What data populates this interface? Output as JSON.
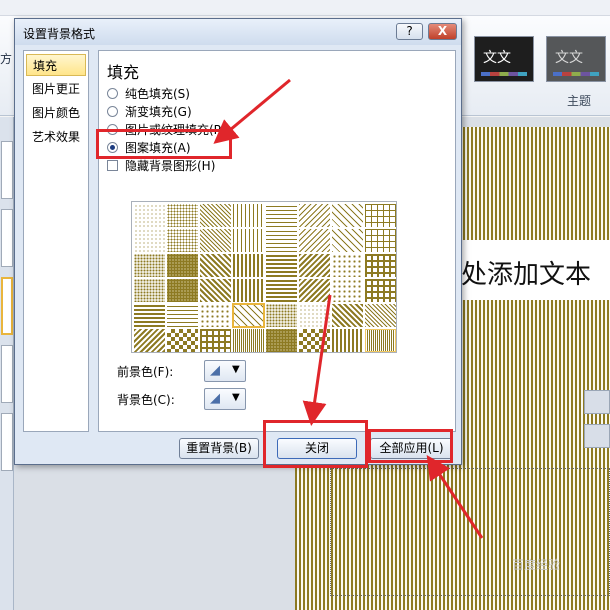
{
  "app": {
    "left_cut_label": "方",
    "theme_label": "主题",
    "theme_tiles": [
      {
        "text": "文文",
        "bg": "#1e1e1e",
        "fg": "#ffffff"
      },
      {
        "text": "文文",
        "bg": "#555759",
        "fg": "#d8d8d8"
      }
    ],
    "slide_text": "处添加文本"
  },
  "dialog": {
    "title": "设置背景格式",
    "help_label": "?",
    "close_label": "X",
    "nav": [
      {
        "label": "填充",
        "selected": true
      },
      {
        "label": "图片更正",
        "selected": false
      },
      {
        "label": "图片颜色",
        "selected": false
      },
      {
        "label": "艺术效果",
        "selected": false
      }
    ],
    "section_title": "填充",
    "options": [
      {
        "label": "纯色填充(S)",
        "type": "radio",
        "checked": false
      },
      {
        "label": "渐变填充(G)",
        "type": "radio",
        "checked": false
      },
      {
        "label": "图片或纹理填充(P)",
        "type": "radio",
        "checked": false
      },
      {
        "label": "图案填充(A)",
        "type": "radio",
        "checked": true
      },
      {
        "label": "隐藏背景图形(H)",
        "type": "checkbox",
        "checked": false
      }
    ],
    "pattern_selected_index": 35,
    "foreground_label": "前景色(F):",
    "background_label": "背景色(C):",
    "pattern_color": "#8d7a22",
    "buttons": {
      "reset": "重置背景(B)",
      "close": "关闭",
      "apply_all": "全部应用(L)"
    }
  },
  "annotation_color": "#e0262b",
  "watermark": "百度经验"
}
